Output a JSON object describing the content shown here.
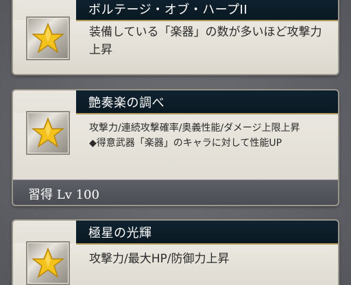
{
  "skills": [
    {
      "title": "ボルテージ・オブ・ハープII",
      "description": "装備している「楽器」の数が多いほど攻撃力上昇",
      "icon": "gold-star-icon"
    },
    {
      "title": "艶奏楽の調べ",
      "description_lines": [
        "攻撃力/連続攻撃確率/奥義性能/ダメージ上限上昇",
        "◆得意武器「楽器」のキャラに対して性能UP"
      ],
      "acquire_label": "習得",
      "acquire_level": "Lv 100",
      "icon": "gold-star-icon"
    },
    {
      "title": "極星の光輝",
      "description": "攻撃力/最大HP/防御力上昇",
      "icon": "gold-star-icon"
    }
  ],
  "colors": {
    "header_bg": "#0f2230",
    "star_gold": "#f4c21c",
    "card_bg": "#e9e6df",
    "footer_bg": "#4f5258"
  }
}
